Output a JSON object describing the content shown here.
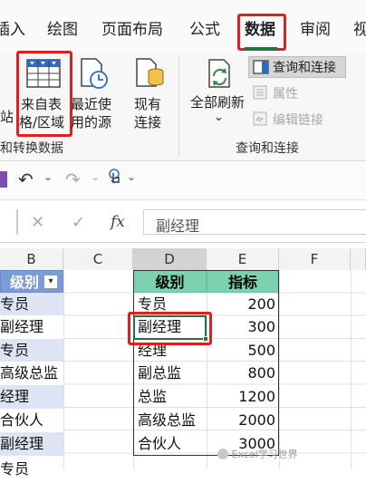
{
  "tabs": [
    "插入",
    "绘图",
    "页面布局",
    "公式",
    "数据",
    "审阅",
    "视"
  ],
  "ribbon": {
    "from_table": "来自表格/区域",
    "from_table_line1": "来自表",
    "from_table_line2": "格/区域",
    "recent_line1": "最近使",
    "recent_line2": "用的源",
    "existing_line1": "现有",
    "existing_line2": "连接",
    "refresh_all": "全部刷新",
    "queries_connections": "查询和连接",
    "properties": "属性",
    "edit_links": "编辑链接",
    "left_partial": "站",
    "group_get_transform": "和转换数据",
    "group_queries": "查询和连接"
  },
  "formula_bar": {
    "cancel": "✕",
    "enter": "✓",
    "fx": "fx",
    "value": "副经理"
  },
  "columns": [
    "B",
    "C",
    "D",
    "E",
    "F"
  ],
  "col_b": {
    "header": "级别",
    "cells": [
      "专员",
      "副经理",
      "专员",
      "高级总监",
      "经理",
      "合伙人",
      "副经理",
      "专员"
    ]
  },
  "table": {
    "header_level": "级别",
    "header_metric": "指标",
    "rows": [
      {
        "level": "专员",
        "metric": "200"
      },
      {
        "level": "副经理",
        "metric": "300"
      },
      {
        "level": "经理",
        "metric": "500"
      },
      {
        "level": "副总监",
        "metric": "800"
      },
      {
        "level": "总监",
        "metric": "1200"
      },
      {
        "level": "高级总监",
        "metric": "2000"
      },
      {
        "level": "合伙人",
        "metric": "3000"
      }
    ]
  },
  "watermark": "Excel学习世界",
  "colors": {
    "highlight": "#e02020",
    "table_header": "#7bd1b0",
    "col_b_fill": "#dde4f4",
    "selection": "#217346"
  }
}
